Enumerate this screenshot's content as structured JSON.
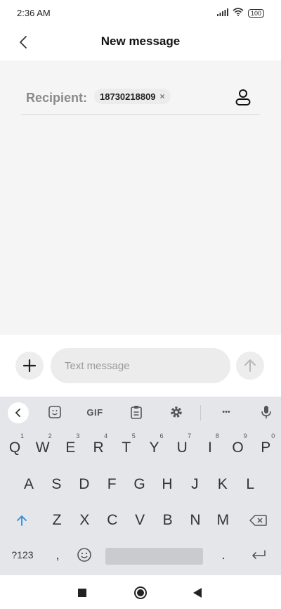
{
  "status": {
    "time": "2:36 AM",
    "battery": "100"
  },
  "header": {
    "title": "New message"
  },
  "recipient": {
    "label": "Recipient:",
    "number": "18730218809",
    "remove": "×"
  },
  "compose": {
    "placeholder": "Text message"
  },
  "keyboard": {
    "toolbar": {
      "gif": "GIF",
      "more": "•••"
    },
    "row1": [
      {
        "k": "Q",
        "h": "1"
      },
      {
        "k": "W",
        "h": "2"
      },
      {
        "k": "E",
        "h": "3"
      },
      {
        "k": "R",
        "h": "4"
      },
      {
        "k": "T",
        "h": "5"
      },
      {
        "k": "Y",
        "h": "6"
      },
      {
        "k": "U",
        "h": "7"
      },
      {
        "k": "I",
        "h": "8"
      },
      {
        "k": "O",
        "h": "9"
      },
      {
        "k": "P",
        "h": "0"
      }
    ],
    "row2": [
      "A",
      "S",
      "D",
      "F",
      "G",
      "H",
      "J",
      "K",
      "L"
    ],
    "row3": [
      "Z",
      "X",
      "C",
      "V",
      "B",
      "N",
      "M"
    ],
    "row4": {
      "symbols": "?123",
      "comma": ",",
      "period": "."
    }
  },
  "colors": {
    "shift": "#2a8fd8",
    "background": "#f5f5f5",
    "keyboard": "#e4e6ea"
  }
}
